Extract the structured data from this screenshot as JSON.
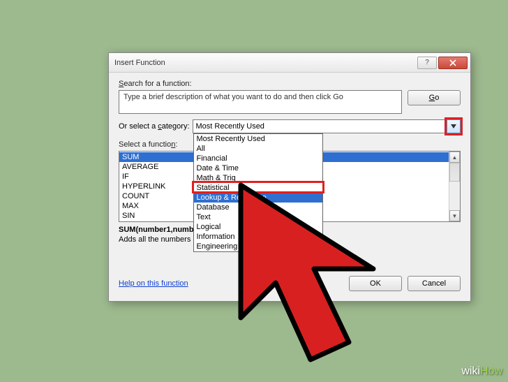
{
  "dialog": {
    "title": "Insert Function",
    "search_label": "Search for a function:",
    "search_text": "Type a brief description of what you want to do and then click Go",
    "go_label": "Go",
    "category_label": "Or select a category:",
    "category_value": "Most Recently Used",
    "category_options": [
      "Most Recently Used",
      "All",
      "Financial",
      "Date & Time",
      "Math & Trig",
      "Statistical",
      "Lookup & Reference",
      "Database",
      "Text",
      "Logical",
      "Information",
      "Engineering"
    ],
    "highlighted_option": "Lookup & Reference",
    "select_function_label": "Select a function:",
    "functions": [
      "SUM",
      "AVERAGE",
      "IF",
      "HYPERLINK",
      "COUNT",
      "MAX",
      "SIN"
    ],
    "signature": "SUM(number1,number2,...)",
    "description": "Adds all the numbers in a range of cells.",
    "help_link": "Help on this function",
    "ok_label": "OK",
    "cancel_label": "Cancel"
  },
  "watermark": "wikiHow"
}
